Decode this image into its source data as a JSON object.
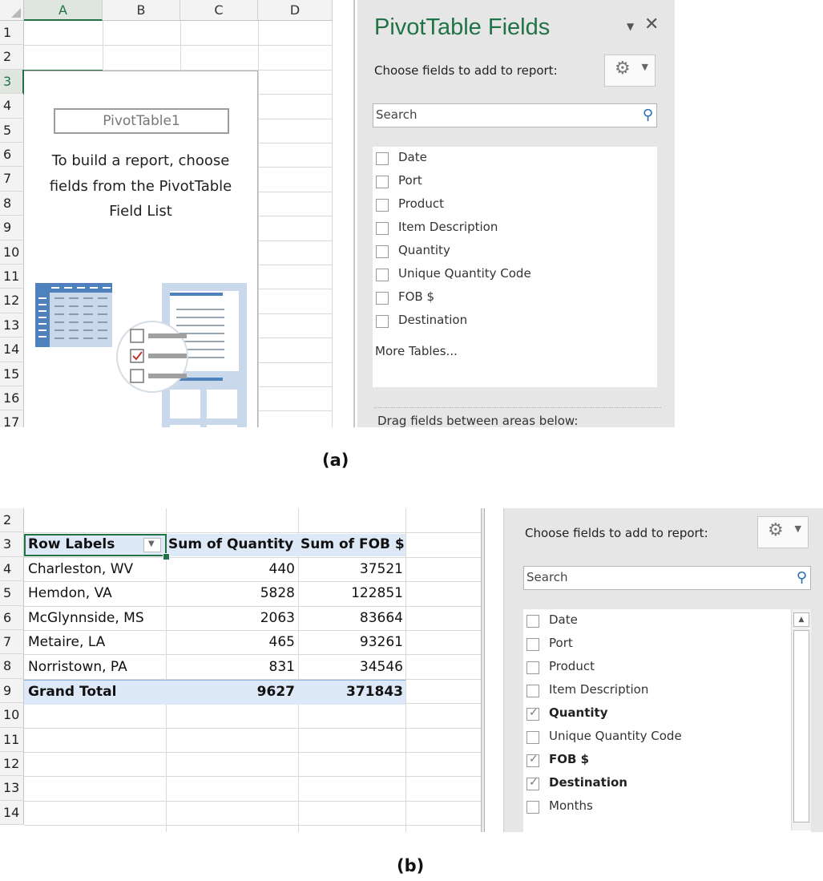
{
  "panel_a": {
    "columns": [
      "A",
      "B",
      "C",
      "D"
    ],
    "rows": [
      "1",
      "2",
      "3",
      "4",
      "5",
      "6",
      "7",
      "8",
      "9",
      "10",
      "11",
      "12",
      "13",
      "14",
      "15",
      "16",
      "17"
    ],
    "pivot_name": "PivotTable1",
    "instructions": [
      "To build a report, choose",
      "fields from the PivotTable",
      "Field List"
    ],
    "field_pane": {
      "title": "PivotTable Fields",
      "choose_label": "Choose fields to add to report:",
      "search_placeholder": "Search",
      "fields": [
        {
          "label": "Date",
          "checked": false
        },
        {
          "label": "Port",
          "checked": false
        },
        {
          "label": "Product",
          "checked": false
        },
        {
          "label": "Item Description",
          "checked": false
        },
        {
          "label": "Quantity",
          "checked": false
        },
        {
          "label": "Unique Quantity Code",
          "checked": false
        },
        {
          "label": "FOB $",
          "checked": false
        },
        {
          "label": "Destination",
          "checked": false
        }
      ],
      "more_tables": "More Tables...",
      "drag_label": "Drag fields between areas below:"
    },
    "caption": "(a)"
  },
  "panel_b": {
    "rows": [
      "2",
      "3",
      "4",
      "5",
      "6",
      "7",
      "8",
      "9",
      "10",
      "11",
      "12",
      "13",
      "14"
    ],
    "headers": [
      "Row Labels",
      "Sum of Quantity",
      "Sum of FOB $"
    ],
    "data": [
      {
        "label": "Charleston, WV",
        "qty": "440",
        "fob": "37521"
      },
      {
        "label": "Hemdon, VA",
        "qty": "5828",
        "fob": "122851"
      },
      {
        "label": "McGlynnside, MS",
        "qty": "2063",
        "fob": "83664"
      },
      {
        "label": "Metaire, LA",
        "qty": "465",
        "fob": "93261"
      },
      {
        "label": "Norristown, PA",
        "qty": "831",
        "fob": "34546"
      }
    ],
    "total": {
      "label": "Grand Total",
      "qty": "9627",
      "fob": "371843"
    },
    "field_pane": {
      "choose_label": "Choose fields to add to report:",
      "search_placeholder": "Search",
      "fields": [
        {
          "label": "Date",
          "checked": false
        },
        {
          "label": "Port",
          "checked": false
        },
        {
          "label": "Product",
          "checked": false
        },
        {
          "label": "Item Description",
          "checked": false
        },
        {
          "label": "Quantity",
          "checked": true
        },
        {
          "label": "Unique Quantity Code",
          "checked": false
        },
        {
          "label": "FOB $",
          "checked": true
        },
        {
          "label": "Destination",
          "checked": true
        },
        {
          "label": "Months",
          "checked": false
        }
      ]
    },
    "caption": "(b)"
  },
  "icons": {
    "gear": "gear-icon",
    "search": "search-icon",
    "close": "close-icon",
    "dropdown": "chevron-down-icon"
  }
}
